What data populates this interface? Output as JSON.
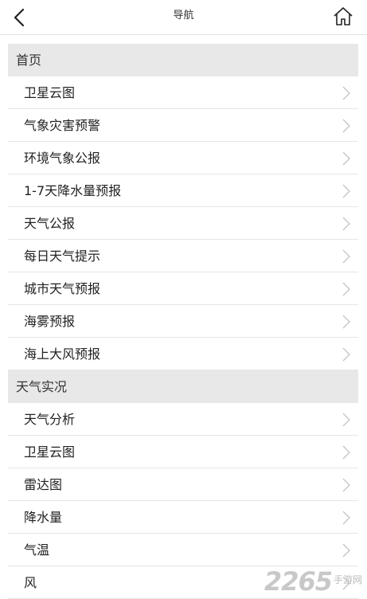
{
  "header": {
    "title": "导航",
    "back_icon": "chevron-left-icon",
    "home_icon": "home-icon"
  },
  "sections": [
    {
      "title": "首页",
      "items": [
        {
          "label": "卫星云图"
        },
        {
          "label": "气象灾害预警"
        },
        {
          "label": "环境气象公报"
        },
        {
          "label": "1-7天降水量预报"
        },
        {
          "label": "天气公报"
        },
        {
          "label": "每日天气提示"
        },
        {
          "label": "城市天气预报"
        },
        {
          "label": "海雾预报"
        },
        {
          "label": "海上大风预报"
        }
      ]
    },
    {
      "title": "天气实况",
      "items": [
        {
          "label": "天气分析"
        },
        {
          "label": "卫星云图"
        },
        {
          "label": "雷达图"
        },
        {
          "label": "降水量"
        },
        {
          "label": "气温"
        },
        {
          "label": "风"
        }
      ]
    }
  ],
  "watermark": {
    "number": "2265",
    "text": "手游网"
  },
  "colors": {
    "section_bg": "#e8e8e8",
    "divider": "#e6e6e6",
    "chevron": "#c4c4c4"
  }
}
